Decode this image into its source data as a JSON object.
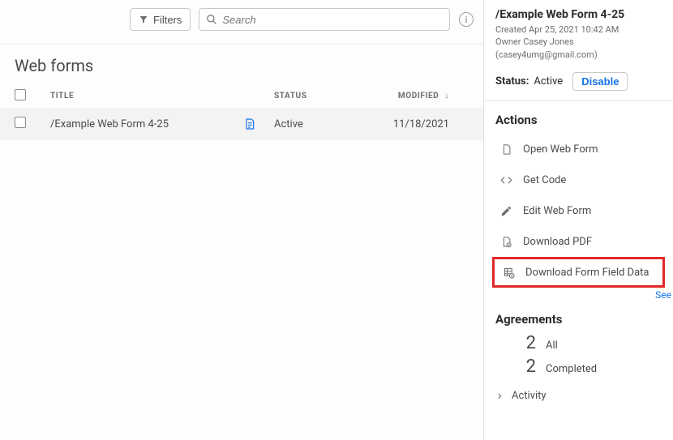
{
  "toolbar": {
    "filters_label": "Filters",
    "search_placeholder": "Search"
  },
  "page_title": "Web forms",
  "columns": {
    "title": "TITLE",
    "status": "STATUS",
    "modified": "MODIFIED"
  },
  "rows": [
    {
      "title": "/Example Web Form 4-25",
      "status": "Active",
      "modified": "11/18/2021"
    }
  ],
  "details": {
    "title": "/Example Web Form 4-25",
    "created": "Created Apr 25, 2021 10:42 AM",
    "owner": "Owner Casey Jones (casey4umg@gmail.com)",
    "status_label": "Status:",
    "status_value": "Active",
    "disable_label": "Disable"
  },
  "actions": {
    "heading": "Actions",
    "items": [
      {
        "label": "Open Web Form"
      },
      {
        "label": "Get Code"
      },
      {
        "label": "Edit Web Form"
      },
      {
        "label": "Download PDF"
      },
      {
        "label": "Download Form Field Data"
      }
    ],
    "see_label": "See"
  },
  "agreements": {
    "heading": "Agreements",
    "items": [
      {
        "count": "2",
        "label": "All"
      },
      {
        "count": "2",
        "label": "Completed"
      }
    ]
  },
  "activity_label": "Activity"
}
